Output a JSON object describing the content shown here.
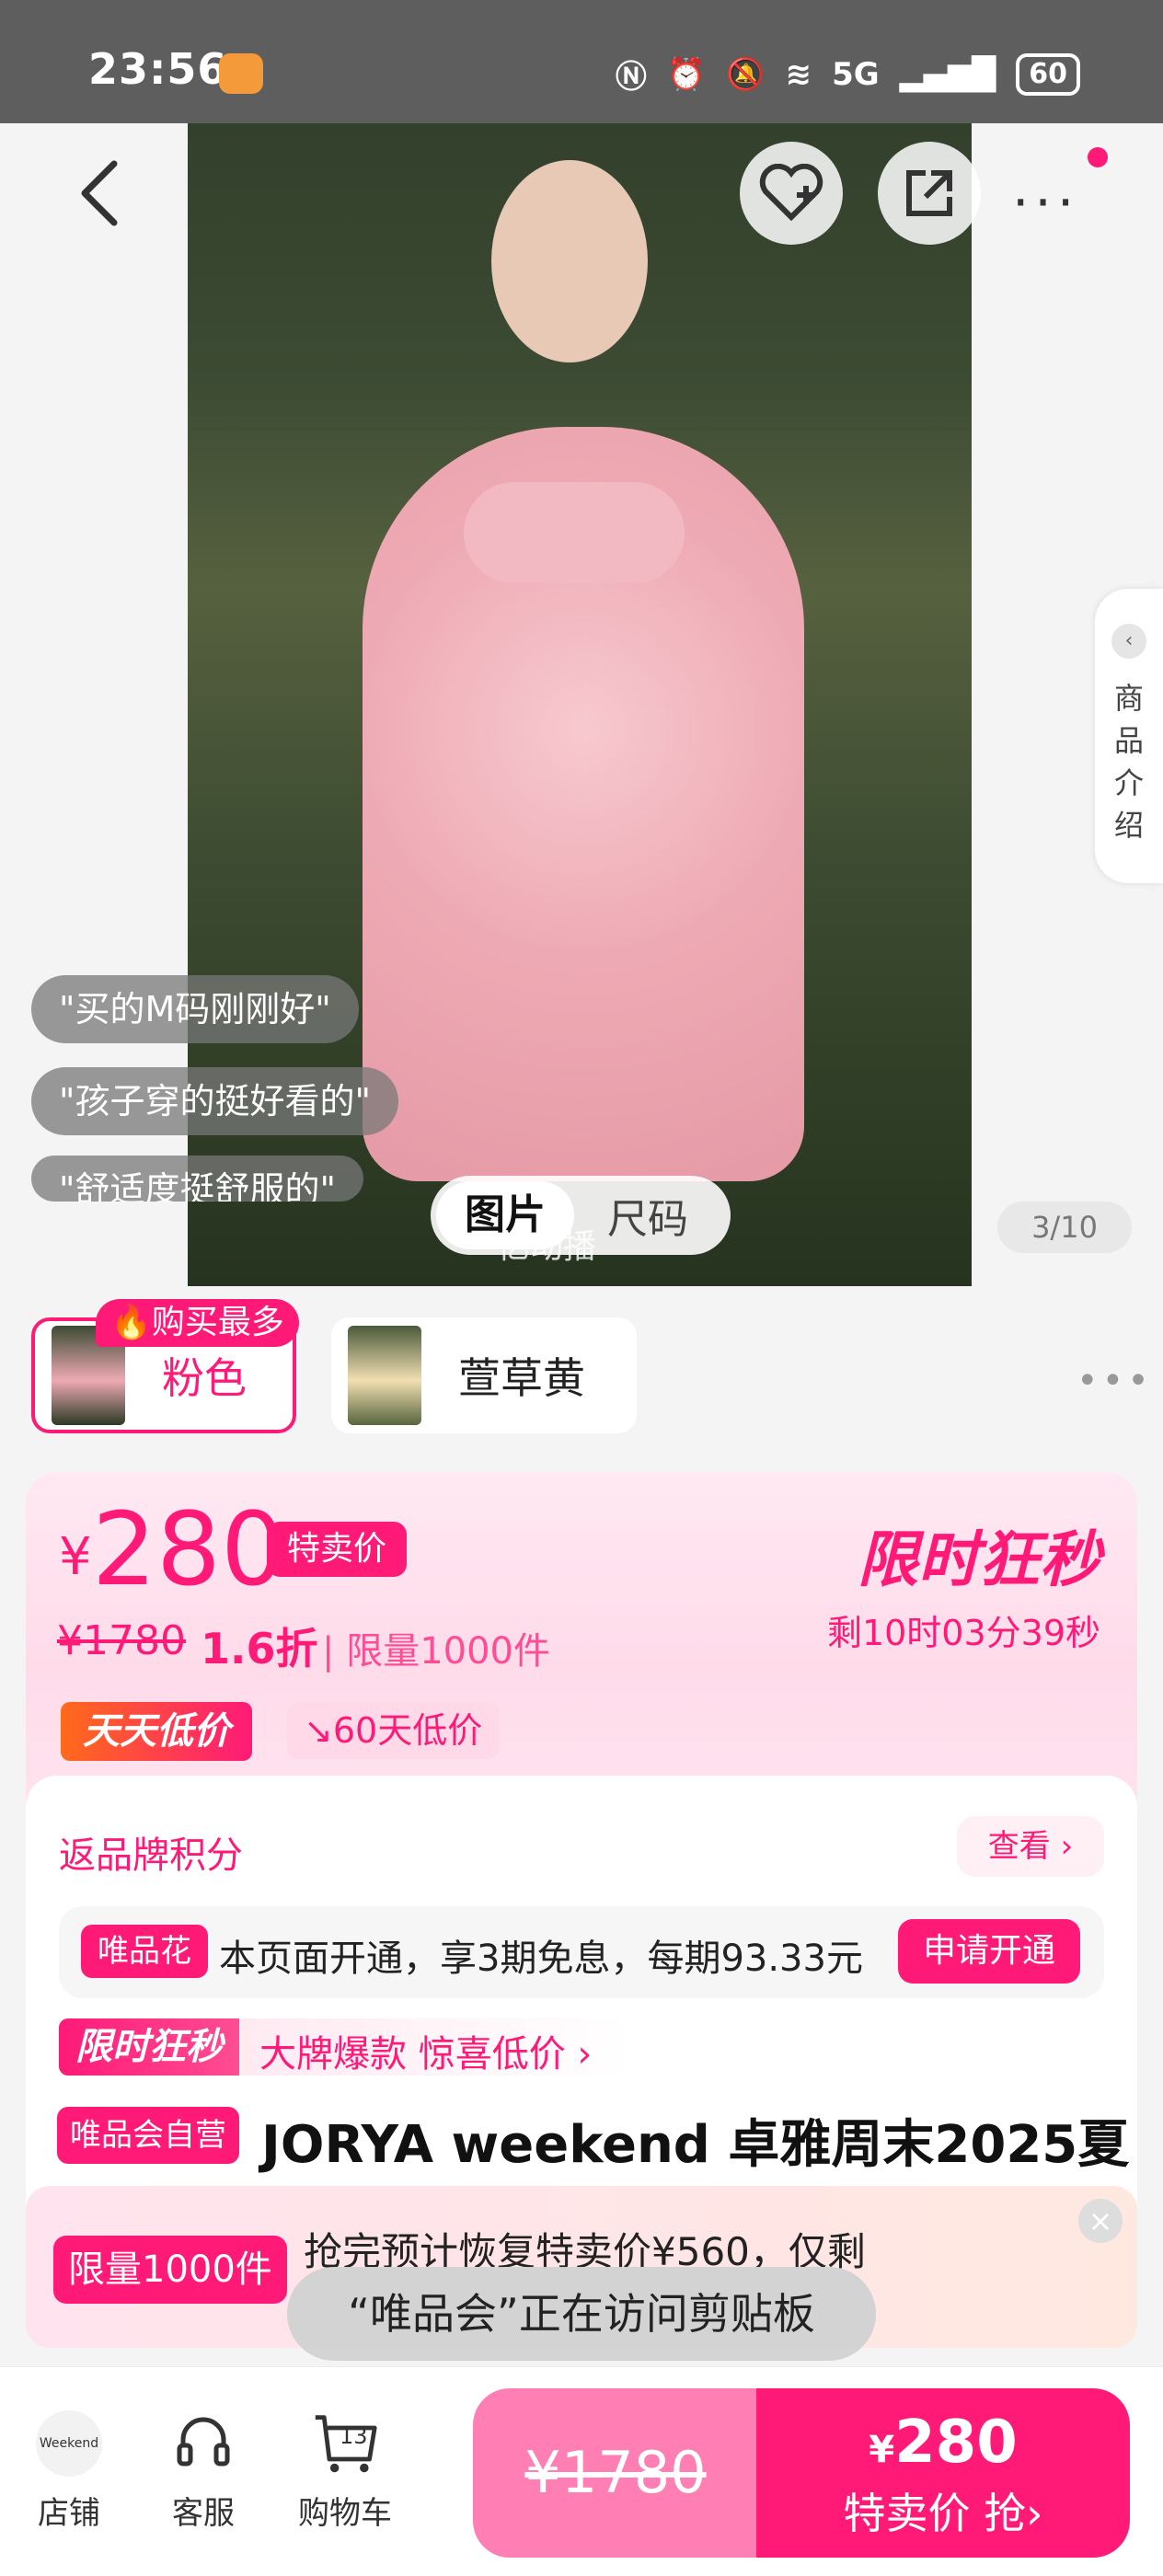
{
  "status_bar": {
    "time": "23:56",
    "battery": "60",
    "network": "5G"
  },
  "gallery": {
    "review_bubbles": [
      "\"买的M码刚刚好\"",
      "\"孩子穿的挺好看的\"",
      "\"舒适度挺舒服的\""
    ],
    "tabs": [
      "图片",
      "尺码"
    ],
    "pager": "3/10",
    "side_tab": "商品介绍",
    "caption": "亿动播"
  },
  "color_options": {
    "hot_badge": "购买最多",
    "options": [
      {
        "label": "粉色",
        "selected": true
      },
      {
        "label": "萱草黄",
        "selected": false
      }
    ]
  },
  "price": {
    "currency": "¥",
    "current": "280",
    "special_tag": "特卖价",
    "original": "¥1780",
    "discount": "1.6折",
    "limit": "| 限量1000件",
    "flash_title": "限时狂秒",
    "countdown": "剩10时03分39秒",
    "daily_low": "天天低价",
    "low_60": "60天低价"
  },
  "benefits": {
    "points": "返品牌积分",
    "view": "查看 ›",
    "vip_tag": "唯品花",
    "vip_text": "本页面开通，享3期免息，每期93.33元",
    "apply": "申请开通",
    "flash_tag": "限时狂秒",
    "flash_text": "大牌爆款 惊喜低价 ›",
    "self_tag": "唯品会自营",
    "product_title": "JORYA weekend 卓雅周末2025夏"
  },
  "notice": {
    "tag": "限量1000件",
    "text": "抢完预计恢复特卖价¥560，仅剩",
    "close": "×"
  },
  "toast": "“唯品会”正在访问剪贴板",
  "bottom_bar": {
    "store": "店铺",
    "service": "客服",
    "cart": "购物车",
    "cart_count": "13",
    "store_logo": "Weekend",
    "buy_left_price": "¥1780",
    "buy_right_currency": "¥",
    "buy_right_price": "280",
    "buy_right_label": "特卖价 抢›"
  },
  "colors": {
    "accent": "#ff1a78",
    "accent_light": "#ff7fb5"
  }
}
